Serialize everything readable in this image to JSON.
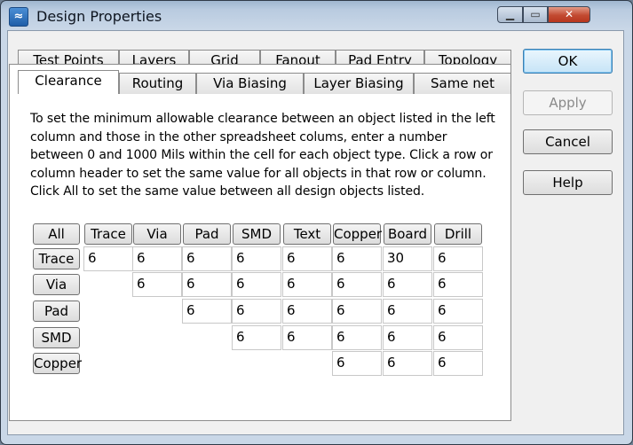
{
  "window": {
    "title": "Design Properties",
    "icon": "app-logo-icon",
    "controls": {
      "minimize": "minimize-icon",
      "maximize": "maximize-icon",
      "close": "close-icon"
    }
  },
  "tabs": {
    "row_back": [
      "Test Points",
      "Layers",
      "Grid",
      "Fanout",
      "Pad Entry",
      "Topology"
    ],
    "row_front": [
      "Clearance",
      "Routing",
      "Via Biasing",
      "Layer Biasing",
      "Same net"
    ],
    "active": "Clearance"
  },
  "instructions": "To set the minimum allowable clearance between an object listed in the left column and those in the other spreadsheet colums, enter a number between 0 and 1000 Mils within the cell for each object type. Click a row or column header to set the same value for all objects in that row or column. Click All to set the same value between all design objects listed.",
  "grid": {
    "all_label": "All",
    "columns": [
      "Trace",
      "Via",
      "Pad",
      "SMD",
      "Text",
      "Copper",
      "Board",
      "Drill"
    ],
    "rows": [
      {
        "label": "Trace",
        "values": [
          "6",
          "6",
          "6",
          "6",
          "6",
          "6",
          "30",
          "6"
        ]
      },
      {
        "label": "Via",
        "values": [
          "",
          "6",
          "6",
          "6",
          "6",
          "6",
          "6",
          "6"
        ]
      },
      {
        "label": "Pad",
        "values": [
          "",
          "",
          "6",
          "6",
          "6",
          "6",
          "6",
          "6"
        ]
      },
      {
        "label": "SMD",
        "values": [
          "",
          "",
          "",
          "6",
          "6",
          "6",
          "6",
          "6"
        ]
      },
      {
        "label": "Copper",
        "values": [
          "",
          "",
          "",
          "",
          "",
          "6",
          "6",
          "6"
        ]
      }
    ]
  },
  "buttons": {
    "ok": "OK",
    "apply": "Apply",
    "cancel": "Cancel",
    "help": "Help",
    "apply_enabled": false
  }
}
